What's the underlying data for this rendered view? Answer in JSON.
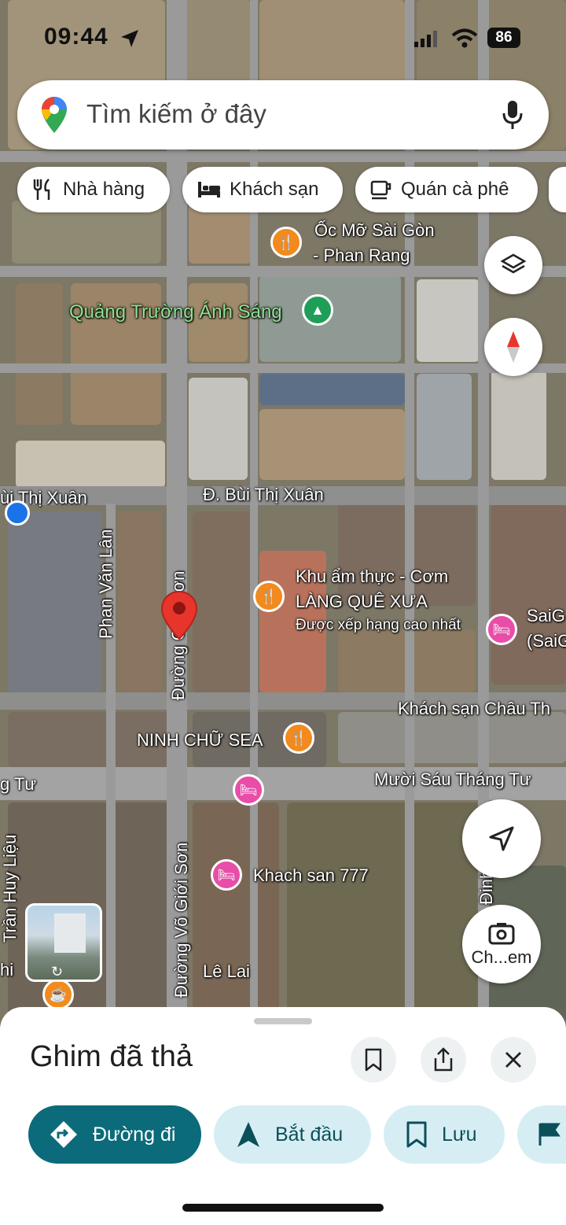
{
  "status_bar": {
    "time": "09:44",
    "battery": "86"
  },
  "search": {
    "placeholder": "Tìm kiếm ở đây"
  },
  "chips": [
    {
      "label": "Nhà hàng",
      "icon": "fork-knife-icon"
    },
    {
      "label": "Khách sạn",
      "icon": "bed-icon"
    },
    {
      "label": "Quán cà phê",
      "icon": "coffee-cup-icon"
    }
  ],
  "map_labels": {
    "oc_mo_line1": "Ốc Mỡ Sài Gòn",
    "oc_mo_line2": "- Phan Rang",
    "quang_truong": "Quảng Trường Ánh Sáng",
    "bui_thi_xuan_left": "ùi Thị Xuân",
    "bui_thi_xuan": "Đ. Bùi Thị Xuân",
    "phan_van_lan": "Phan Văn Lân",
    "duong_gioi_son_top": "Đường Giới Sơn",
    "khu_am_thuc_line1": "Khu ẩm thực - Cơm",
    "khu_am_thuc_line2": "LÀNG QUÊ XƯA",
    "khu_am_thuc_line3": "Được xếp hạng cao nhất",
    "saigon_line1": "SaiG",
    "saigon_line2": "(SaiG",
    "khach_san_chau": "Khách sạn Châu Th",
    "ninh_chu_sea": "NINH CHỮ SEA",
    "tu_left": "g Tư",
    "muoi_sau": "Mười Sáu Tháng Tư",
    "tran_huy_lieu": "Trần Huy Liệu",
    "khach_san_777": "Khach san 777",
    "duong_vo_gioi_son": "Đường Võ Giới Sơn",
    "le_lai": "Lê Lai",
    "right_edge": "Đinh",
    "left_edge": "hi"
  },
  "camera_button": {
    "label": "Ch...em"
  },
  "sheet": {
    "title": "Ghim đã thả",
    "actions": [
      {
        "label": "Đường đi",
        "icon": "directions-icon"
      },
      {
        "label": "Bắt đầu",
        "icon": "navigation-arrow-icon"
      },
      {
        "label": "Lưu",
        "icon": "bookmark-icon"
      }
    ]
  },
  "colors": {
    "primary": "#0b6b7a",
    "pin_red": "#e8352b",
    "chip_bg": "#d6eef3"
  }
}
